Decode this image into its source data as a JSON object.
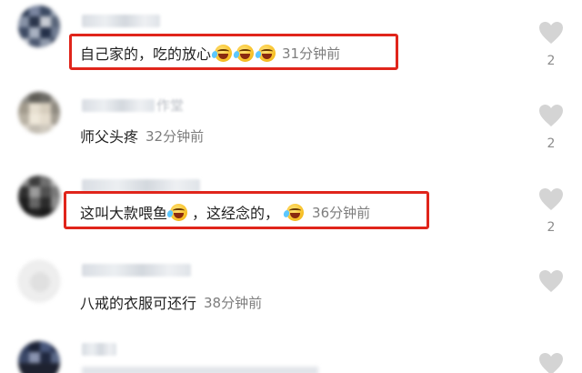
{
  "comments": [
    {
      "text_parts": [
        "自己家的，吃的放心"
      ],
      "emoji_after_text": 3,
      "time": "31分钟前",
      "likes": "2",
      "highlighted": true
    },
    {
      "username_fragment": "作堂",
      "text": "师父头疼",
      "time": "32分钟前",
      "likes": "2",
      "highlighted": false
    },
    {
      "text_part_a": "这叫大款喂鱼",
      "text_part_b": "，这经念的，",
      "time": "36分钟前",
      "likes": "2",
      "highlighted": true
    },
    {
      "text": "八戒的衣服可还行",
      "time": "38分钟前",
      "highlighted": false
    }
  ],
  "icons": {
    "like": "heart-icon",
    "emoji": "laughing-crying-emoji-icon"
  },
  "colors": {
    "highlight_border": "#e0251b",
    "time_text": "#7d7d7d",
    "heart": "#d4d4d4"
  }
}
